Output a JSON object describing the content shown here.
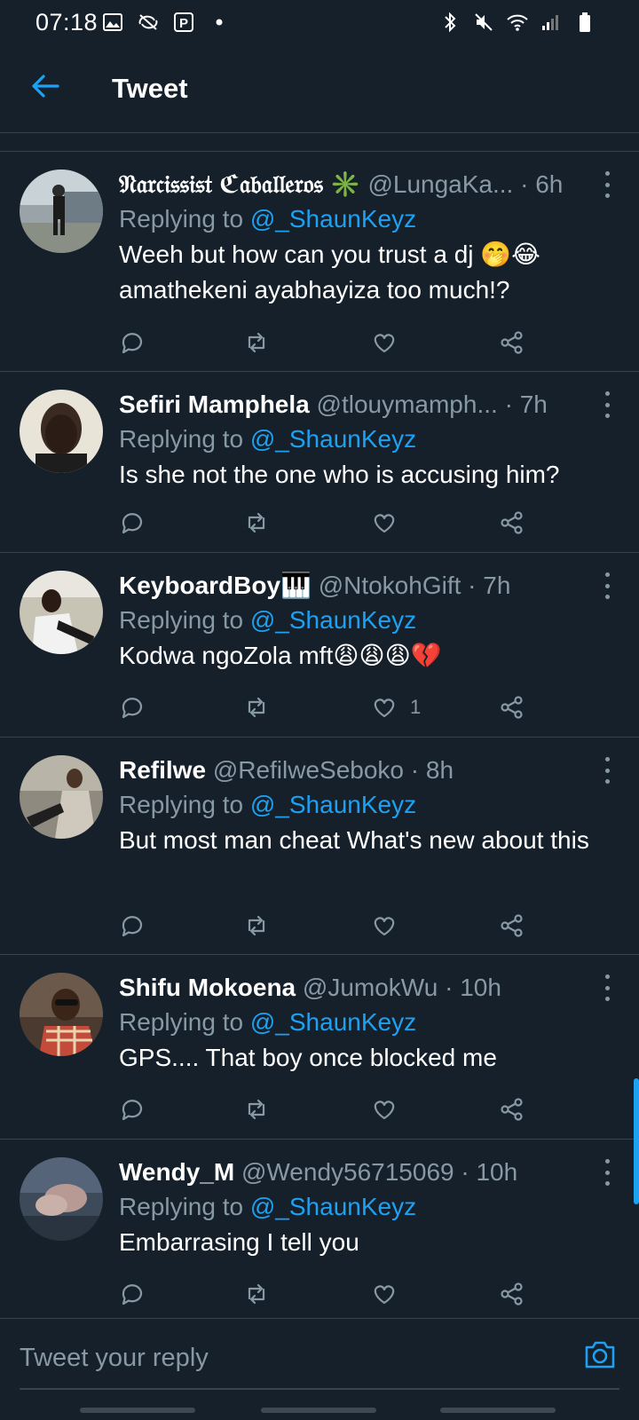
{
  "status_bar": {
    "time": "07:18",
    "left_icons": [
      "gallery-icon",
      "no-rotate-icon",
      "parking-icon",
      "dot-icon"
    ],
    "right_icons": [
      "bluetooth-icon",
      "mute-icon",
      "wifi-icon",
      "signal-icon",
      "battery-icon"
    ]
  },
  "header": {
    "title": "Tweet",
    "back_icon": "arrow-left-icon"
  },
  "colors": {
    "background": "#15202b",
    "accent": "#1da1f2",
    "secondary_text": "#8899a6",
    "divider": "#38444d"
  },
  "replies": [
    {
      "name": "𝔑𝔞𝔯𝔠𝔦𝔰𝔰𝔦𝔰𝔱 ℭ𝔞𝔟𝔞𝔩𝔩𝔢𝔯𝔬𝔰 ✳️",
      "handle": "@LungaKa...",
      "time": "6h",
      "replying_prefix": "Replying to ",
      "replying_to": "@_ShaunKeyz",
      "text": "Weeh but how can you trust a dj 🤭😂 amathekeni ayabhayiza too much!?",
      "like_count": ""
    },
    {
      "name": "Sefiri Mamphela",
      "handle": "@tlouymamph...",
      "time": "7h",
      "replying_prefix": "Replying to ",
      "replying_to": "@_ShaunKeyz",
      "text": "Is she not the one who is accusing him?",
      "like_count": ""
    },
    {
      "name": "KeyboardBoy🎹",
      "handle": "@NtokohGift",
      "time": "7h",
      "replying_prefix": "Replying to ",
      "replying_to": "@_ShaunKeyz",
      "text": "Kodwa ngoZola mft😩😩😩💔",
      "like_count": "1"
    },
    {
      "name": "Refilwe",
      "handle": "@RefilweSeboko",
      "time": "8h",
      "replying_prefix": "Replying to ",
      "replying_to": "@_ShaunKeyz",
      "text": "But most man cheat What's new about this",
      "like_count": ""
    },
    {
      "name": "Shifu Mokoena",
      "handle": "@JumokWu",
      "time": "10h",
      "replying_prefix": "Replying to ",
      "replying_to": "@_ShaunKeyz",
      "text": "GPS.... That boy once blocked me",
      "like_count": ""
    },
    {
      "name": "Wendy_M",
      "handle": "@Wendy56715069",
      "time": "10h",
      "replying_prefix": "Replying to ",
      "replying_to": "@_ShaunKeyz",
      "text": "Embarrasing I tell you",
      "like_count": ""
    }
  ],
  "reply_bar": {
    "placeholder": "Tweet your reply",
    "camera_icon": "camera-icon"
  }
}
